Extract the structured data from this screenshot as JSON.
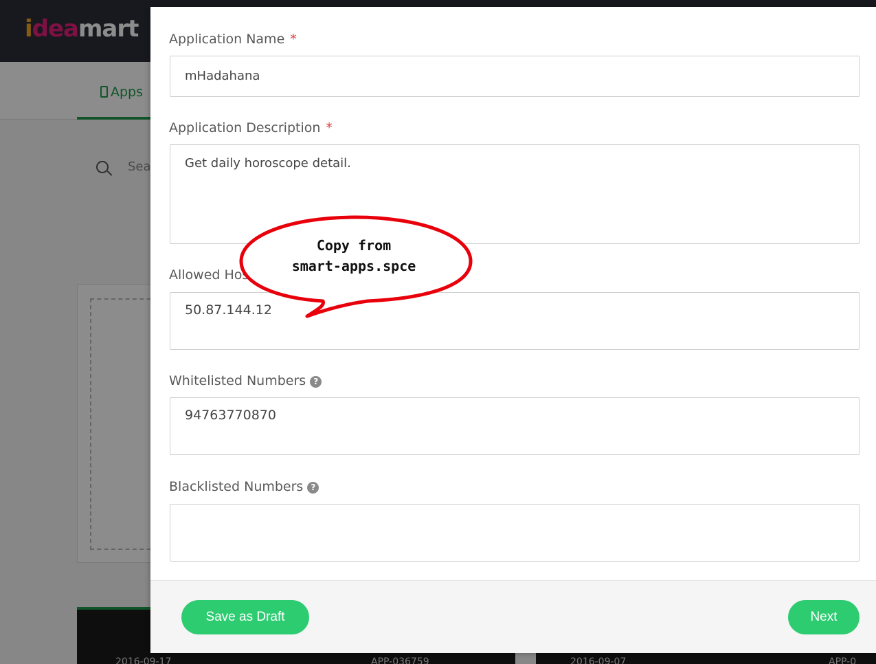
{
  "background": {
    "logo": {
      "part1": "i",
      "part2": "dea",
      "part3": "mart"
    },
    "nav_tab_label": "Apps",
    "search_placeholder": "Sea",
    "thumb_texts": [
      "2016-09-17",
      "APP-036759",
      "2016-09-07",
      "APP-0"
    ]
  },
  "form": {
    "fields": [
      {
        "label": "Application Name",
        "required": "*",
        "value": "mHadahana"
      },
      {
        "label": "Application Description",
        "required": "*",
        "value": "Get daily horoscope detail."
      },
      {
        "label": "Allowed Host",
        "value": "50.87.144.12"
      },
      {
        "label": "Whitelisted Numbers",
        "help": "?",
        "value": "94763770870"
      },
      {
        "label": "Blacklisted Numbers",
        "help": "?",
        "value": ""
      }
    ]
  },
  "footer": {
    "save_draft_label": "Save as Draft",
    "next_label": "Next"
  },
  "callout": {
    "line1": "Copy from",
    "line2": "smart-apps.spce",
    "color": "#e8000b"
  },
  "colors": {
    "accent_green": "#2ecc71",
    "nav_green": "#1f9a4b",
    "header_dark": "#2b2f3a",
    "required_red": "#e03c3c"
  }
}
